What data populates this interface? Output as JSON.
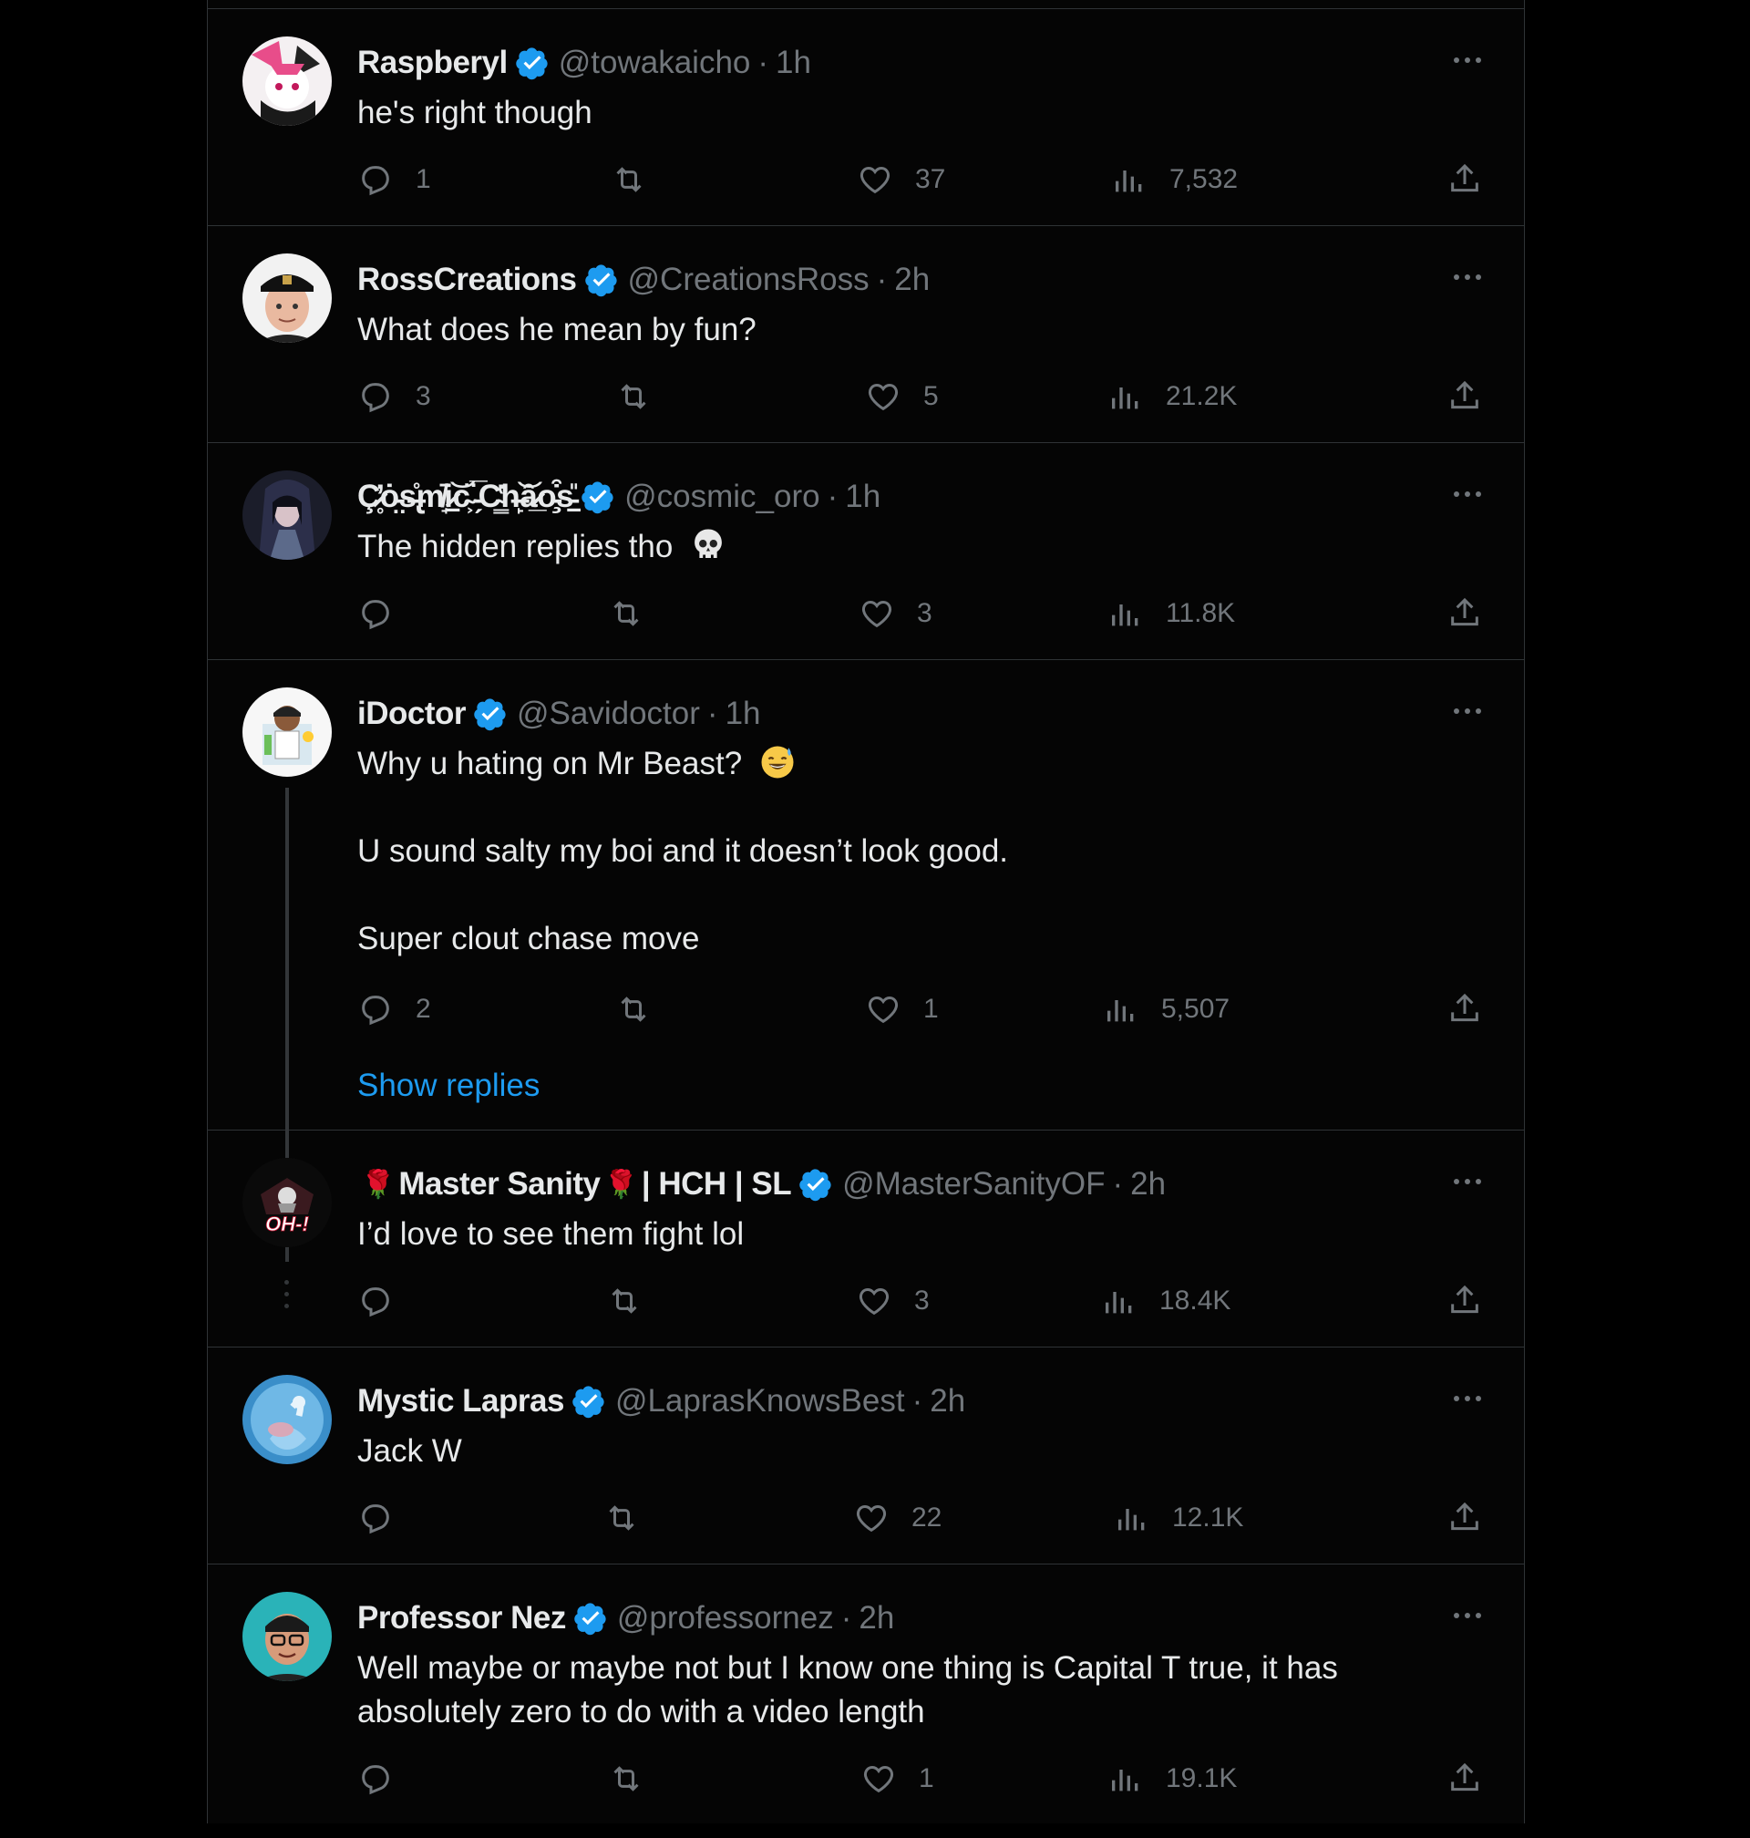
{
  "colors": {
    "background": "#000000",
    "text": "#e7e9ea",
    "muted": "#71767b",
    "verified": "#1d9bf0",
    "link": "#1d9bf0"
  },
  "tweets": [
    {
      "name": "Raspberyl",
      "handle": "@towakaicho",
      "time": "1h",
      "text": [
        "he's right though"
      ],
      "replies": "1",
      "retweets": "",
      "likes": "37",
      "views": "7,532",
      "avatar": "anime-pink-avatar"
    },
    {
      "name": "RossCreations",
      "handle": "@CreationsRoss",
      "time": "2h",
      "text": [
        "What does he mean by fun?"
      ],
      "replies": "3",
      "retweets": "",
      "likes": "5",
      "views": "21.2K",
      "avatar": "man-cap-avatar"
    },
    {
      "name": "Ç̷̥̓ȯ̵̤s̶̢̊m̸̘̄i̷̠͝c̴͕̈ ̵̗̅C̴͇̔h̶̙͝ȃ̷̲o̵̧͒s̵̠̎",
      "handle": "@cosmic_oro",
      "time": "1h",
      "text": [
        "The hidden replies tho"
      ],
      "text_emoji": "skull-emoji",
      "replies": "",
      "retweets": "",
      "likes": "3",
      "views": "11.8K",
      "avatar": "anime-dark-avatar"
    },
    {
      "name": "iDoctor",
      "handle": "@Savidoctor",
      "time": "1h",
      "text": [
        "Why u hating on Mr Beast?",
        "U sound salty my boi and it doesn’t look good.",
        "Super clout chase move"
      ],
      "text_emoji": "sweat-smile-emoji",
      "replies": "2",
      "retweets": "",
      "likes": "1",
      "views": "5,507",
      "avatar": "doctor-avatar",
      "show_replies": "Show replies"
    },
    {
      "name_prefix": "🌹",
      "name": "Master Sanity",
      "name_mid": "🌹",
      "name_suffix": "| HCH | SL",
      "handle": "@MasterSanityOF",
      "time": "2h",
      "text": [
        "I’d love to see them fight lol"
      ],
      "replies": "",
      "retweets": "",
      "likes": "3",
      "views": "18.4K",
      "avatar": "oh-logo-avatar",
      "avatar_text": "OH-!"
    },
    {
      "name": "Mystic Lapras",
      "handle": "@LaprasKnowsBest",
      "time": "2h",
      "text": [
        "Jack W"
      ],
      "replies": "",
      "retweets": "",
      "likes": "22",
      "views": "12.1K",
      "avatar": "lapras-avatar"
    },
    {
      "name": "Professor Nez",
      "handle": "@professornez",
      "time": "2h",
      "text": [
        "Well maybe or maybe not but I know one thing  is Capital T true, it has absolutely zero to do with a video length"
      ],
      "replies": "",
      "retweets": "",
      "likes": "1",
      "views": "19.1K",
      "avatar": "man-glasses-avatar"
    }
  ],
  "separator": "·"
}
